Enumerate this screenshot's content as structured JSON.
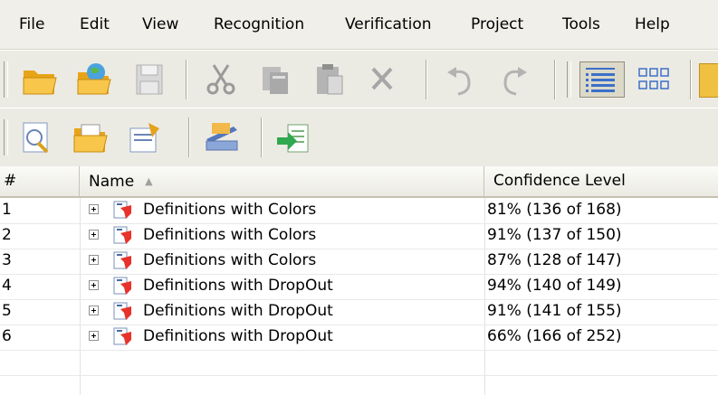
{
  "menu": [
    {
      "label": "File"
    },
    {
      "label": "Edit"
    },
    {
      "label": "View"
    },
    {
      "label": "Recognition"
    },
    {
      "label": "Verification"
    },
    {
      "label": "Project"
    },
    {
      "label": "Tools"
    },
    {
      "label": "Help"
    }
  ],
  "toolbar1": [
    "open-folder-icon",
    "open-web-icon",
    "save-icon",
    "cut-icon",
    "copy-icon",
    "paste-icon",
    "delete-icon",
    "undo-icon",
    "redo-icon",
    "details-view-icon",
    "thumbnails-view-icon"
  ],
  "toolbar2": [
    "definition-settings-icon",
    "open-batch-icon",
    "properties-icon",
    "scan-icon",
    "export-icon"
  ],
  "grid": {
    "columns": {
      "number": "#",
      "name": "Name",
      "confidence": "Confidence Level"
    },
    "sort_indicator": "▲",
    "rows": [
      {
        "n": "1",
        "name": "Definitions with Colors",
        "confidence": "81% (136 of 168)"
      },
      {
        "n": "2",
        "name": "Definitions with Colors",
        "confidence": "91% (137 of 150)"
      },
      {
        "n": "3",
        "name": "Definitions with Colors",
        "confidence": "87% (128 of 147)"
      },
      {
        "n": "4",
        "name": "Definitions with DropOut",
        "confidence": "94% (140 of 149)"
      },
      {
        "n": "5",
        "name": "Definitions with DropOut",
        "confidence": "91% (141 of 155)"
      },
      {
        "n": "6",
        "name": "Definitions with DropOut",
        "confidence": "66% (166 of 252)"
      }
    ]
  }
}
